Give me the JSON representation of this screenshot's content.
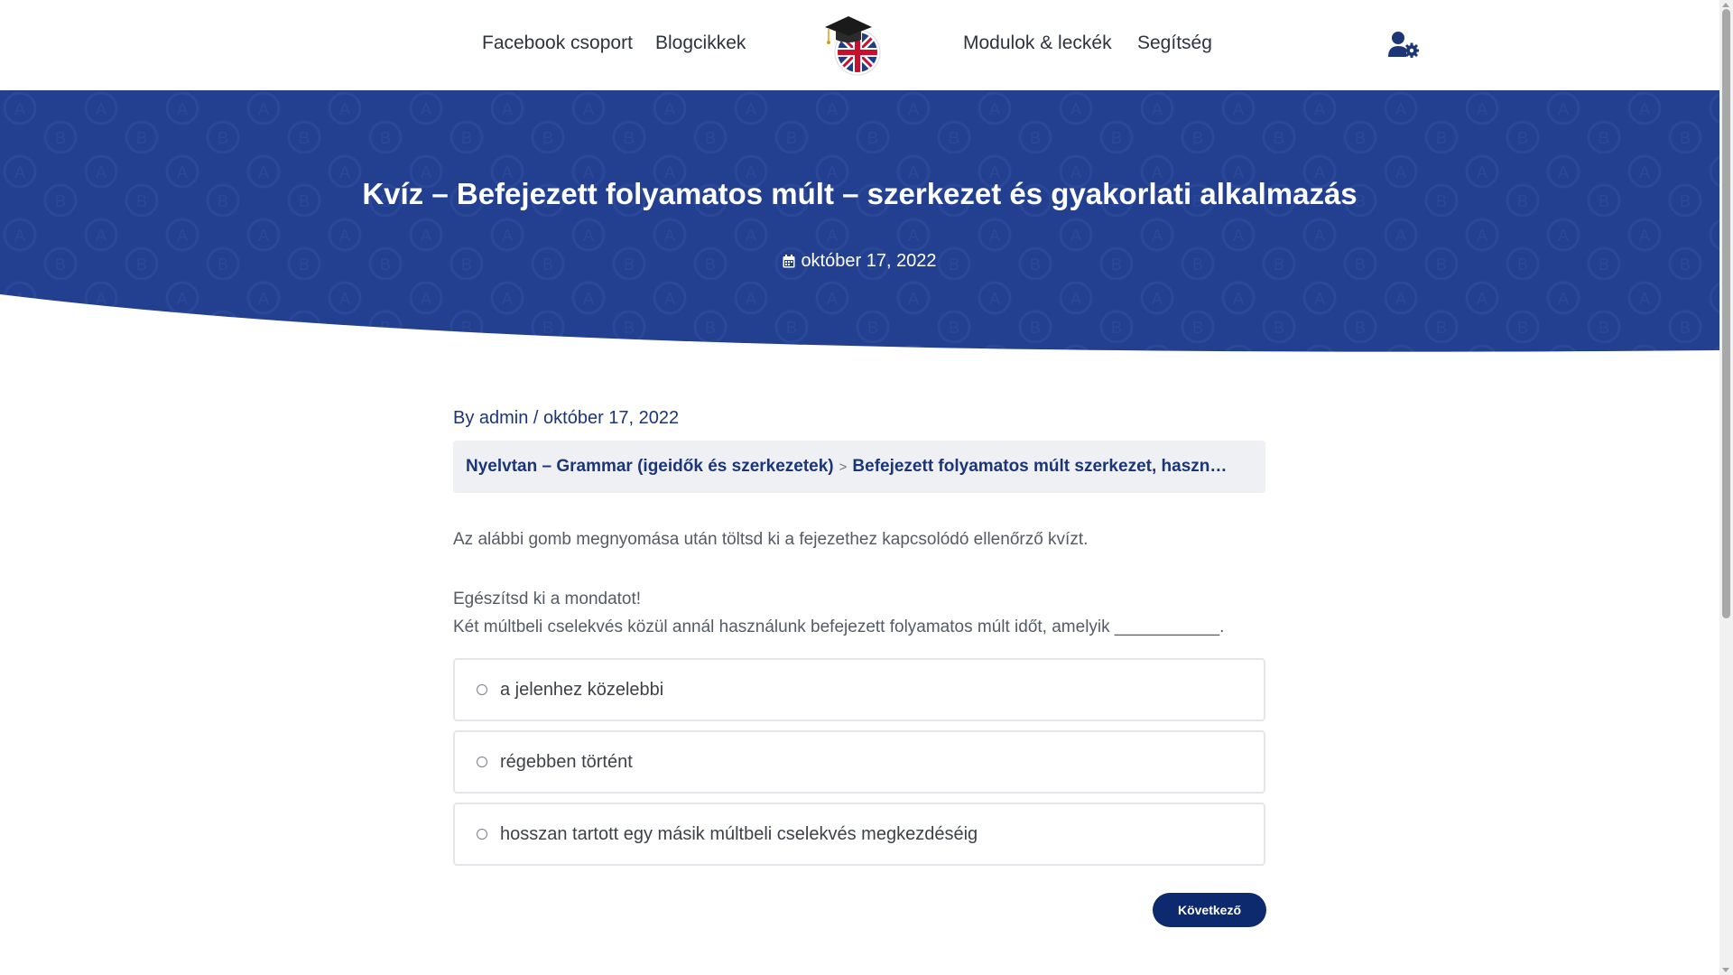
{
  "header": {
    "nav_left": [
      "Facebook csoport",
      "Blogcikkek"
    ],
    "nav_right": [
      "Modulok & leckék",
      "Segítség"
    ],
    "logo_icon": "graduation-cap-uk-flag-logo",
    "user_icon": "user-gear-icon"
  },
  "hero": {
    "title": "Kvíz – Befejezett folyamatos múlt – szerkezet és gyakorlati alkalmazás",
    "date": "október 17, 2022",
    "date_icon": "calendar-icon"
  },
  "meta": {
    "text": "By admin / október 17, 2022"
  },
  "breadcrumb": {
    "items": [
      "Nyelvtan – Grammar (igeidők és szerkezetek)",
      "Befejezett folyamatos múlt szerkezet, haszn…"
    ],
    "separator": ">"
  },
  "content": {
    "intro": "Az alábbi gomb megnyomása után töltsd ki a fejezethez kapcsolódó ellenőrző kvízt.",
    "instruction": "Egészítsd ki a mondatot!",
    "question": "Két múltbeli cselekvés közül annál használunk befejezett folyamatos múlt időt, amelyik  ___________.",
    "options": [
      "a jelenhez közelebbi",
      "régebben történt",
      "hosszan tartott egy másik múltbeli cselekvés megkezdéséig"
    ],
    "next_label": "Következő"
  },
  "colors": {
    "hero_blue": "#233f8f",
    "link_navy": "#1b3576",
    "button_navy": "#0e2a6e"
  }
}
